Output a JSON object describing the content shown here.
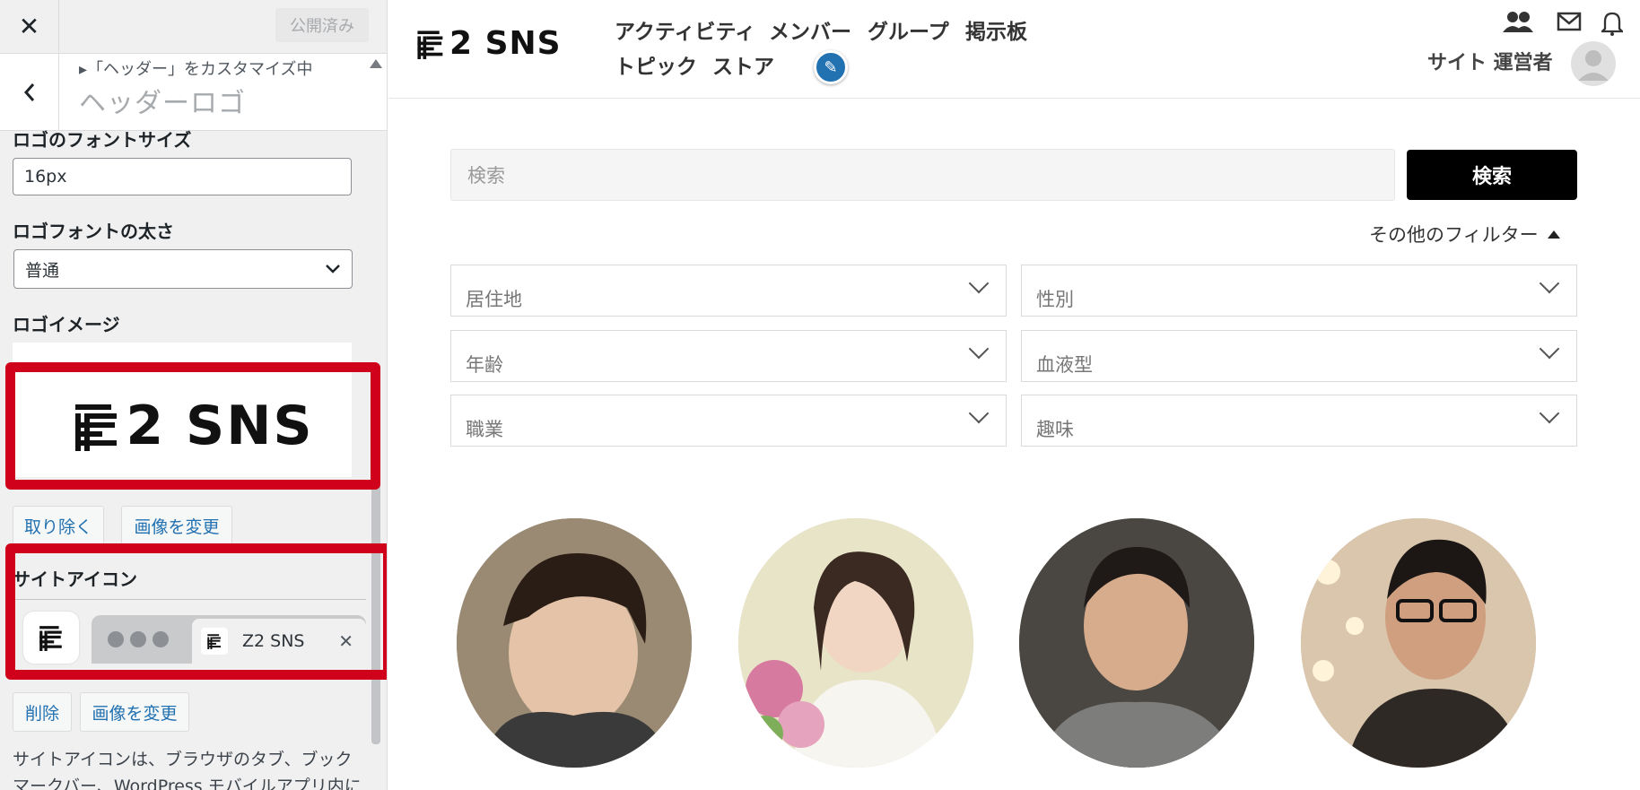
{
  "customizer": {
    "close_label": "✕",
    "publish_label": "公開済み",
    "breadcrumb": "▸「ヘッダー」をカスタマイズ中",
    "section_title": "ヘッダーロゴ",
    "logo_font_size": {
      "label": "ロゴのフォントサイズ",
      "value": "16px"
    },
    "logo_font_weight": {
      "label": "ロゴフォントの太さ",
      "selected": "普通"
    },
    "logo_image": {
      "label": "ロゴイメージ",
      "logo_text": "2 SNS",
      "remove_label": "取り除く",
      "change_label": "画像を変更"
    },
    "site_icon": {
      "label": "サイトアイコン",
      "tab_title": "Z2 SNS",
      "tab_close": "✕",
      "delete_label": "削除",
      "change_label": "画像を変更"
    },
    "description": "サイトアイコンは、ブラウザのタブ、ブックマークバー、WordPress モバイルアプリ内に"
  },
  "site": {
    "logo_text": "2 SNS",
    "nav_row1": [
      "アクティビティ",
      "メンバー",
      "グループ",
      "掲示板"
    ],
    "nav_row2": [
      "トピック",
      "ストア"
    ],
    "user_name": "サイト 運営者",
    "search": {
      "placeholder": "検索",
      "button_label": "検索"
    },
    "more_filters_label": "その他のフィルター",
    "filters": [
      "居住地",
      "性別",
      "年齢",
      "血液型",
      "職業",
      "趣味"
    ],
    "members": [
      {
        "icon": "member-photo-young-man-smiling",
        "bg": "#8a7a66"
      },
      {
        "icon": "member-photo-bride-with-flowers",
        "bg": "#d9d3c3"
      },
      {
        "icon": "member-photo-man-gray-shirt",
        "bg": "#5a5550"
      },
      {
        "icon": "member-photo-man-glasses-suit",
        "bg": "#c9b7a1"
      }
    ]
  },
  "colors": {
    "accent_red": "#d0021b",
    "wp_blue": "#2271b1",
    "search_button": "#000000"
  }
}
